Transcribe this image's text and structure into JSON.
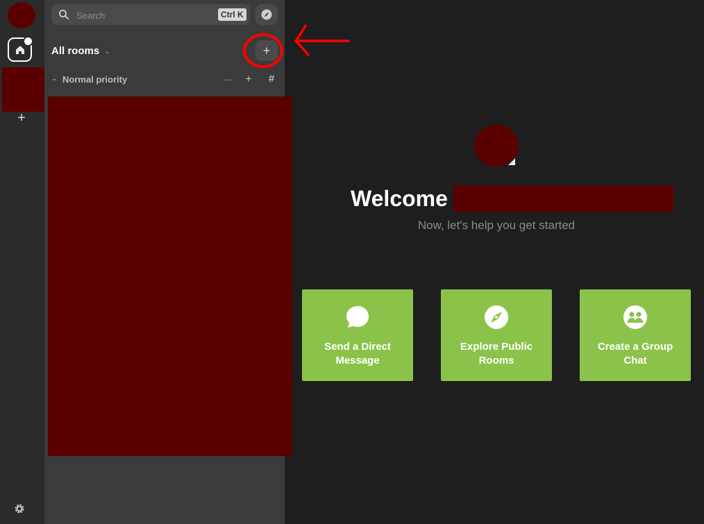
{
  "spacebar": {
    "add_space_label": "+"
  },
  "roomlist": {
    "search": {
      "placeholder": "Search",
      "shortcut": "Ctrl K"
    },
    "title": "All rooms",
    "title_chevron": "⌄",
    "add_room_label": "+",
    "section": {
      "title": "Normal priority",
      "more_label": "···",
      "add_label": "+",
      "explore_label": "#"
    }
  },
  "main": {
    "welcome": "Welcome",
    "subtitle": "Now, let's help you get started",
    "cards": [
      {
        "label": "Send a Direct Message",
        "icon": "chat-bubble-icon"
      },
      {
        "label": "Explore Public Rooms",
        "icon": "compass-icon"
      },
      {
        "label": "Create a Group Chat",
        "icon": "group-icon"
      }
    ]
  },
  "colors": {
    "card_green": "#8bc34a",
    "redaction": "#5a0000",
    "annotation": "#ff0000",
    "sidebar_bg": "#2b2b2b",
    "roomlist_bg": "#3b3b3b",
    "main_bg": "#1e1e1e"
  }
}
